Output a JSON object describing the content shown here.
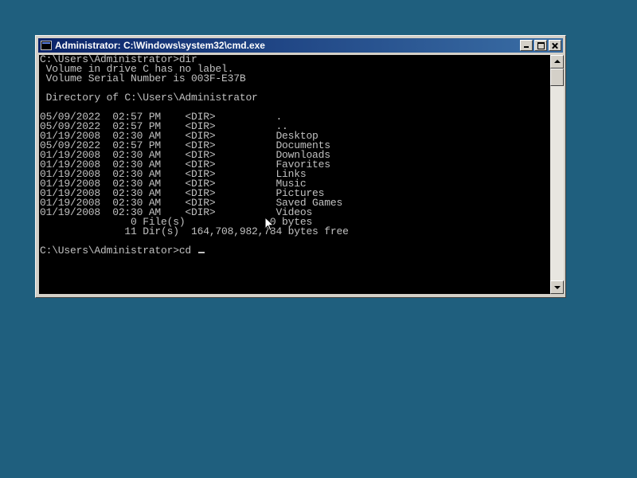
{
  "window": {
    "title": "Administrator: C:\\Windows\\system32\\cmd.exe",
    "icon": "cmd-icon",
    "controls": [
      "minimize-icon",
      "maximize-icon",
      "close-icon"
    ]
  },
  "console": {
    "lines": [
      "C:\\Users\\Administrator>dir",
      " Volume in drive C has no label.",
      " Volume Serial Number is 003F-E37B",
      "",
      " Directory of C:\\Users\\Administrator",
      "",
      "05/09/2022  02:57 PM    <DIR>          .",
      "05/09/2022  02:57 PM    <DIR>          ..",
      "01/19/2008  02:30 AM    <DIR>          Desktop",
      "05/09/2022  02:57 PM    <DIR>          Documents",
      "01/19/2008  02:30 AM    <DIR>          Downloads",
      "01/19/2008  02:30 AM    <DIR>          Favorites",
      "01/19/2008  02:30 AM    <DIR>          Links",
      "01/19/2008  02:30 AM    <DIR>          Music",
      "01/19/2008  02:30 AM    <DIR>          Pictures",
      "01/19/2008  02:30 AM    <DIR>          Saved Games",
      "01/19/2008  02:30 AM    <DIR>          Videos",
      "               0 File(s)              0 bytes",
      "              11 Dir(s)  164,708,982,784 bytes free",
      ""
    ],
    "prompt": "C:\\Users\\Administrator>cd "
  },
  "colors": {
    "desktop": "#1f5f7e",
    "console_bg": "#000000",
    "console_fg": "#c0c0c0",
    "titlebar": "#0a246a"
  }
}
